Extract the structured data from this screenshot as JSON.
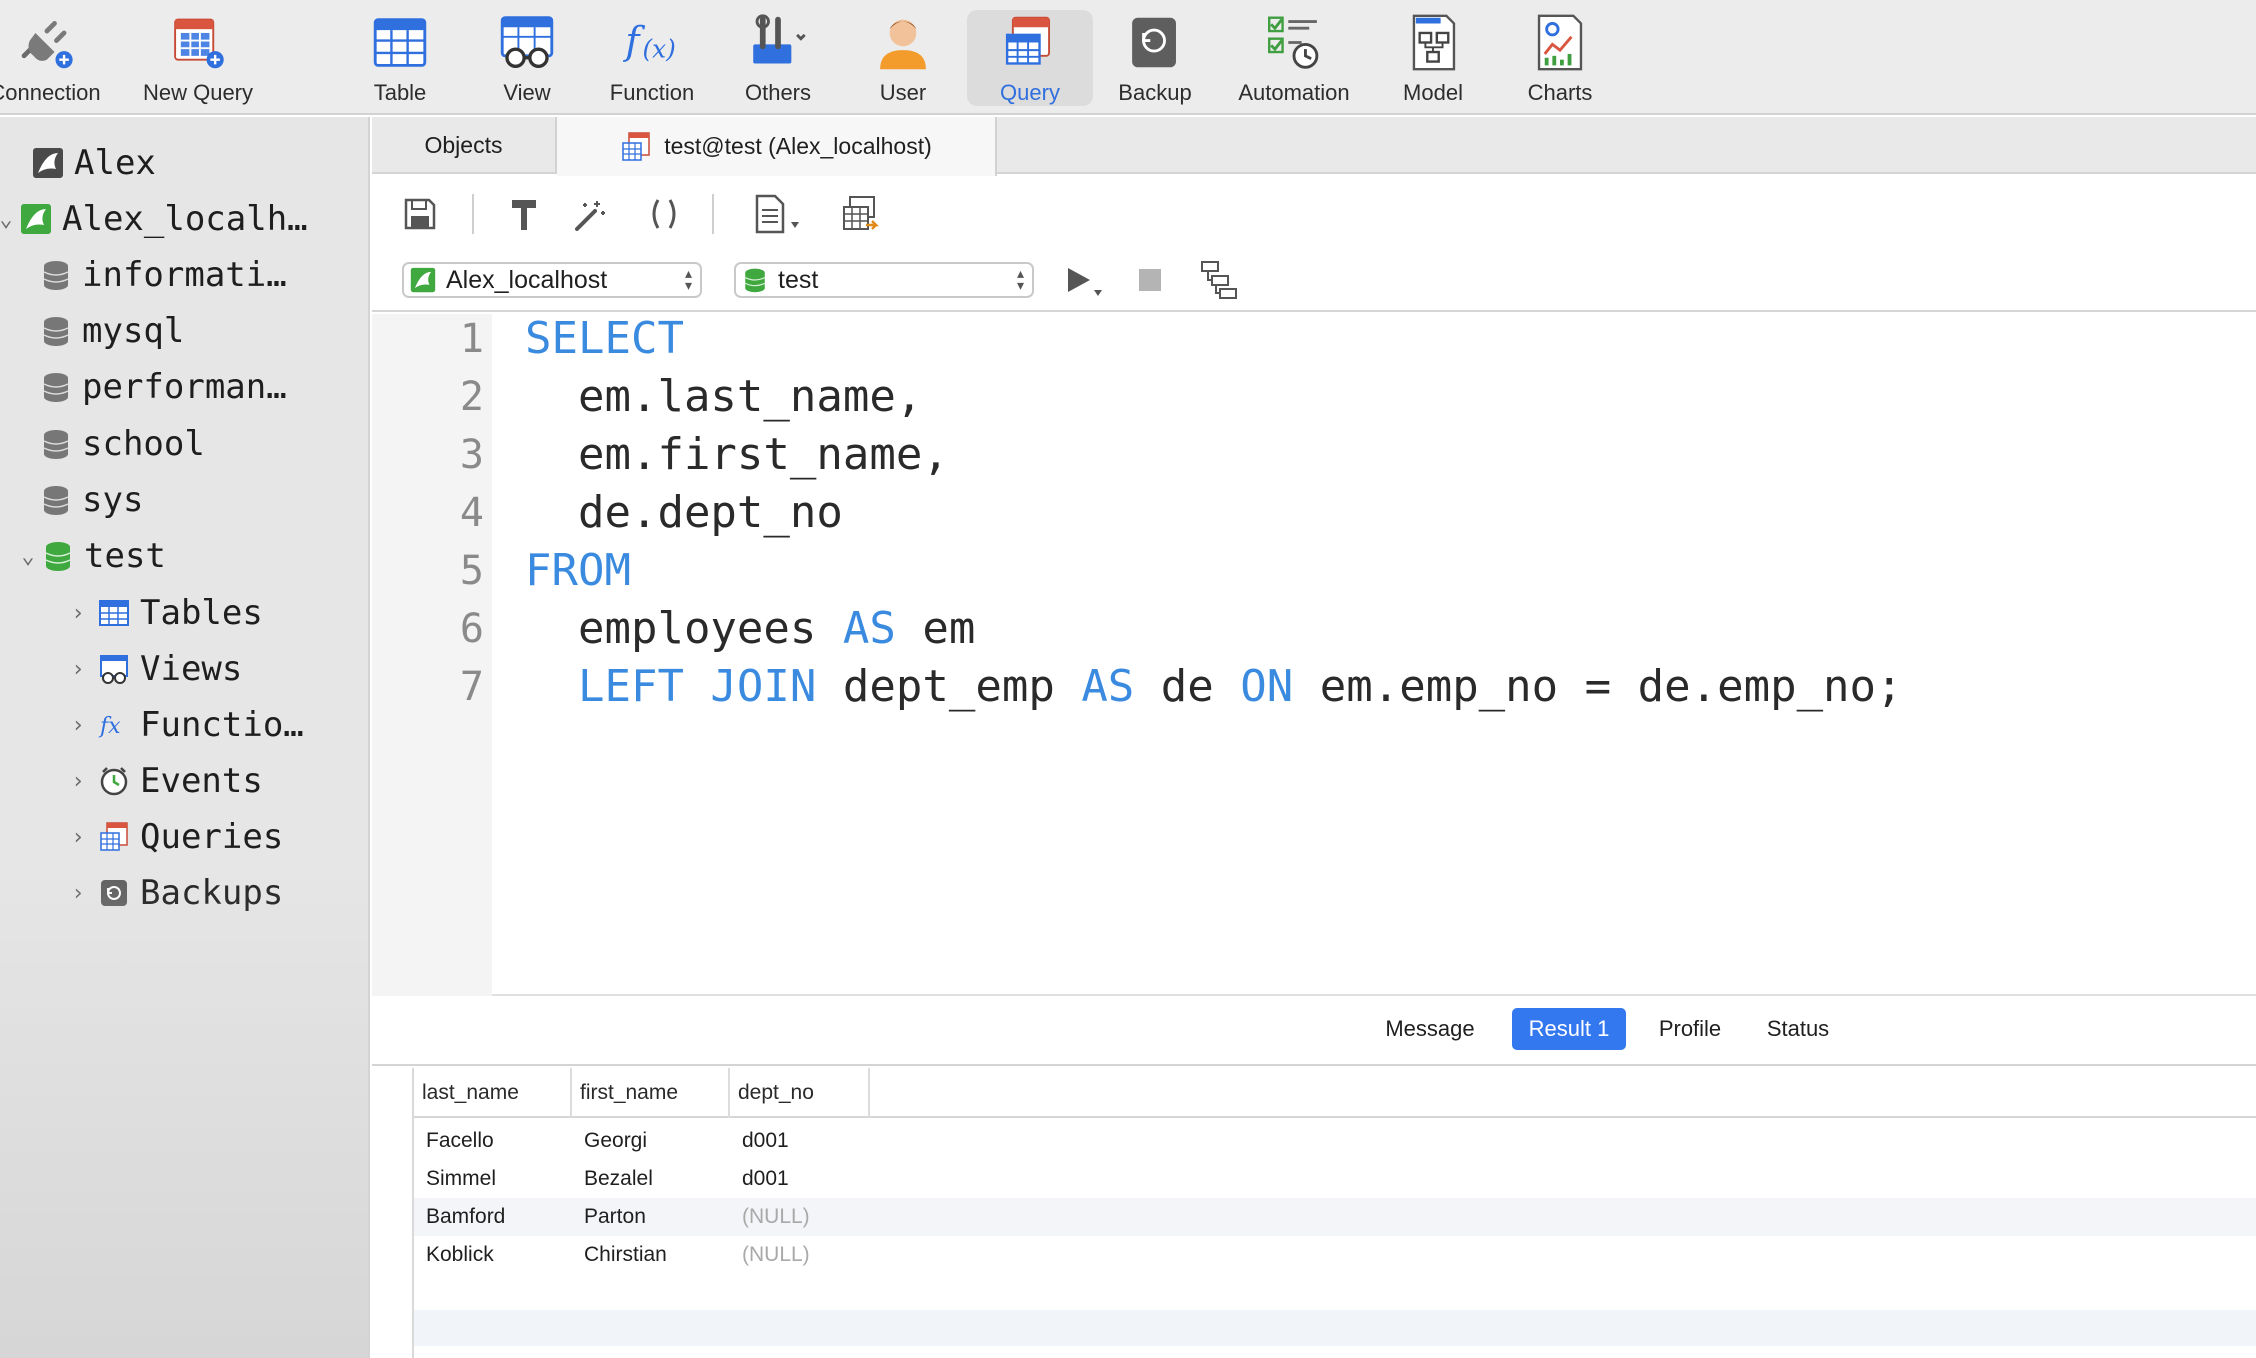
{
  "toolbar": {
    "items": [
      {
        "label": "Connection",
        "icon": "plug-icon"
      },
      {
        "label": "New Query",
        "icon": "new-query-icon"
      },
      {
        "label": "Table",
        "icon": "table-icon"
      },
      {
        "label": "View",
        "icon": "view-icon"
      },
      {
        "label": "Function",
        "icon": "function-icon"
      },
      {
        "label": "Others",
        "icon": "tools-icon"
      },
      {
        "label": "User",
        "icon": "user-icon"
      },
      {
        "label": "Query",
        "icon": "query-icon"
      },
      {
        "label": "Backup",
        "icon": "backup-icon"
      },
      {
        "label": "Automation",
        "icon": "automation-icon"
      },
      {
        "label": "Model",
        "icon": "model-icon"
      },
      {
        "label": "Charts",
        "icon": "charts-icon"
      }
    ],
    "active": "Query"
  },
  "sidebar": {
    "items": [
      {
        "label": "Alex"
      },
      {
        "label": "Alex_localh…"
      },
      {
        "label": "informati…"
      },
      {
        "label": "mysql"
      },
      {
        "label": "performan…"
      },
      {
        "label": "school"
      },
      {
        "label": "sys"
      },
      {
        "label": "test"
      },
      {
        "label": "Tables"
      },
      {
        "label": "Views"
      },
      {
        "label": "Functio…"
      },
      {
        "label": "Events"
      },
      {
        "label": "Queries"
      },
      {
        "label": "Backups"
      }
    ]
  },
  "tabs": {
    "objects": "Objects",
    "query": "test@test (Alex_localhost)"
  },
  "editor": {
    "connection": "Alex_localhost",
    "database": "test",
    "line_numbers": [
      "1",
      "2",
      "3",
      "4",
      "5",
      "6",
      "7"
    ],
    "lines": [
      {
        "kw1": "SELECT",
        "txt1": "",
        "kw2": "",
        "txt2": "",
        "kw3": "",
        "txt3": "",
        "kw4": "",
        "txt4": ""
      },
      {
        "kw1": "",
        "txt1": "  em.last_name,",
        "kw2": "",
        "txt2": "",
        "kw3": "",
        "txt3": "",
        "kw4": "",
        "txt4": ""
      },
      {
        "kw1": "",
        "txt1": "  em.first_name,",
        "kw2": "",
        "txt2": "",
        "kw3": "",
        "txt3": "",
        "kw4": "",
        "txt4": ""
      },
      {
        "kw1": "",
        "txt1": "  de.dept_no",
        "kw2": "",
        "txt2": "",
        "kw3": "",
        "txt3": "",
        "kw4": "",
        "txt4": ""
      },
      {
        "kw1": "FROM",
        "txt1": "",
        "kw2": "",
        "txt2": "",
        "kw3": "",
        "txt3": "",
        "kw4": "",
        "txt4": ""
      },
      {
        "kw1": "",
        "txt1": "  employees ",
        "kw2": "AS",
        "txt2": " em",
        "kw3": "",
        "txt3": "",
        "kw4": "",
        "txt4": ""
      },
      {
        "kw1": "",
        "txt1": "  ",
        "kw2": "LEFT JOIN",
        "txt2": " dept_emp ",
        "kw3": "AS",
        "txt3": " de ",
        "kw4": "ON",
        "txt4": " em.emp_no = de.emp_no;"
      }
    ]
  },
  "results": {
    "tabs": [
      "Message",
      "Result 1",
      "Profile",
      "Status"
    ],
    "active_tab": "Result 1",
    "columns": [
      "last_name",
      "first_name",
      "dept_no"
    ],
    "rows": [
      [
        "Facello",
        "Georgi",
        "d001"
      ],
      [
        "Simmel",
        "Bezalel",
        "d001"
      ],
      [
        "Bamford",
        "Parton",
        "(NULL)"
      ],
      [
        "Koblick",
        "Chirstian",
        "(NULL)"
      ]
    ]
  },
  "colors": {
    "accent": "#3478f0",
    "keyword": "#3a8be0",
    "null_text": "#a9a9a9"
  }
}
